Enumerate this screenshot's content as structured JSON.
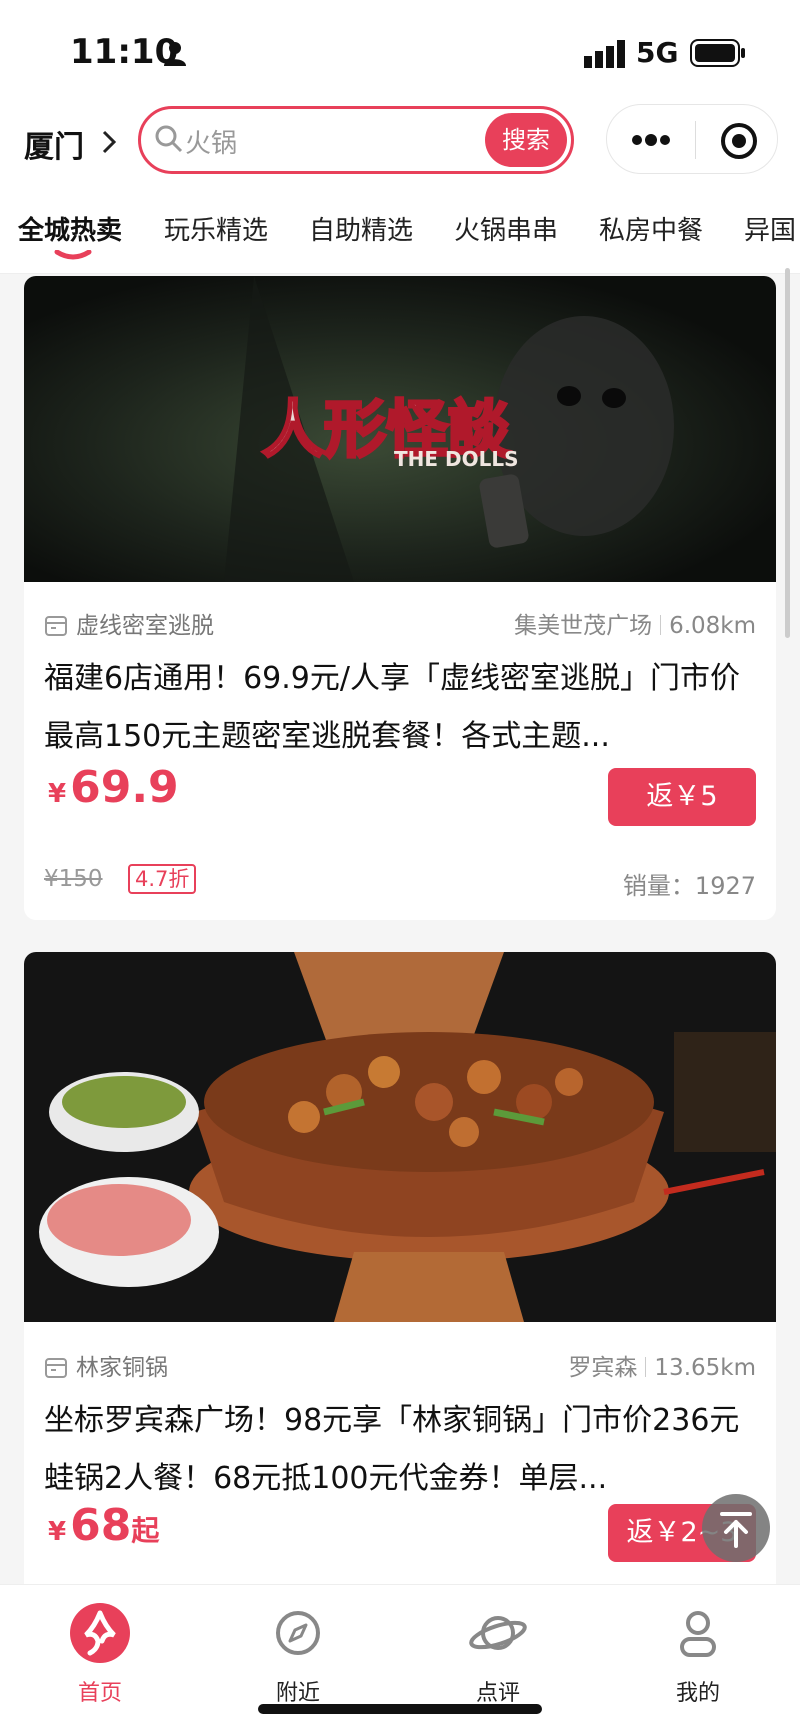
{
  "status_bar": {
    "time": "11:10",
    "network": "5G"
  },
  "header": {
    "city": "厦门",
    "search": {
      "placeholder": "火锅",
      "button_label": "搜索"
    }
  },
  "tabs": [
    {
      "label": "全城热卖",
      "active": true
    },
    {
      "label": "玩乐精选",
      "active": false
    },
    {
      "label": "自助精选",
      "active": false
    },
    {
      "label": "火锅串串",
      "active": false
    },
    {
      "label": "私房中餐",
      "active": false
    },
    {
      "label": "异国",
      "active": false
    }
  ],
  "deals": [
    {
      "image_text": "人形怪談",
      "image_subtext": "THE DOLLS",
      "shop": "虚线密室逃脱",
      "area": "集美世茂广场",
      "distance": "6.08km",
      "title": "福建6店通用！69.9元/人享「虚线密室逃脱」门市价最高150元主题密室逃脱套餐！各式主题...",
      "currency": "¥",
      "price": "69.9",
      "rebate": "返￥5",
      "original_price": "¥150",
      "discount": "4.7折",
      "sales": "销量：1927"
    },
    {
      "shop": "林家铜锅",
      "area": "罗宾森",
      "distance": "13.65km",
      "title": "坐标罗宾森广场！98元享「林家铜锅」门市价236元蛙锅2人餐！68元抵100元代金券！单层...",
      "currency": "¥",
      "price": "68",
      "price_suffix": "起",
      "rebate": "返￥2~3"
    }
  ],
  "bottom_nav": [
    {
      "label": "首页",
      "icon": "home-logo-icon",
      "active": true
    },
    {
      "label": "附近",
      "icon": "compass-icon",
      "active": false
    },
    {
      "label": "点评",
      "icon": "planet-icon",
      "active": false
    },
    {
      "label": "我的",
      "icon": "user-icon",
      "active": false
    }
  ],
  "colors": {
    "accent": "#e8405a",
    "text": "#222222",
    "muted": "#999999",
    "background": "#f5f5f5"
  }
}
